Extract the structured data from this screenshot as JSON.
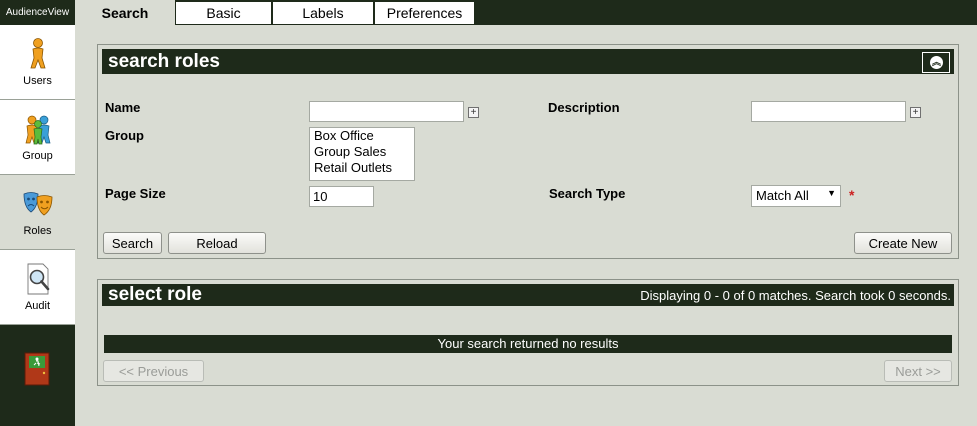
{
  "app": {
    "brand": "AudienceView"
  },
  "sidebar": {
    "items": [
      {
        "label": "Users",
        "icon": "user-icon"
      },
      {
        "label": "Group",
        "icon": "group-icon"
      },
      {
        "label": "Roles",
        "icon": "theater-masks-icon"
      },
      {
        "label": "Audit",
        "icon": "magnifier-document-icon"
      }
    ],
    "exit_icon": "exit-door-icon"
  },
  "tabs": [
    {
      "label": "Search"
    },
    {
      "label": "Basic"
    },
    {
      "label": "Labels"
    },
    {
      "label": "Preferences"
    }
  ],
  "search_panel": {
    "title": "search roles",
    "name_label": "Name",
    "name_value": "",
    "description_label": "Description",
    "description_value": "",
    "group_label": "Group",
    "group_options": [
      "Box Office",
      "Group Sales",
      "Retail Outlets"
    ],
    "page_size_label": "Page Size",
    "page_size_value": "10",
    "search_type_label": "Search Type",
    "search_type_value": "Match All",
    "required_marker": "*",
    "search_button": "Search",
    "reload_button": "Reload",
    "create_button": "Create New"
  },
  "results_panel": {
    "title": "select role",
    "status": "Displaying 0 - 0 of 0 matches. Search took 0 seconds.",
    "empty_message": "Your search returned no results",
    "previous_button": "<< Previous",
    "next_button": "Next >>"
  },
  "colors": {
    "header_dark": "#1e2a1a",
    "background": "#d9dcd3",
    "required": "#cc2222"
  }
}
